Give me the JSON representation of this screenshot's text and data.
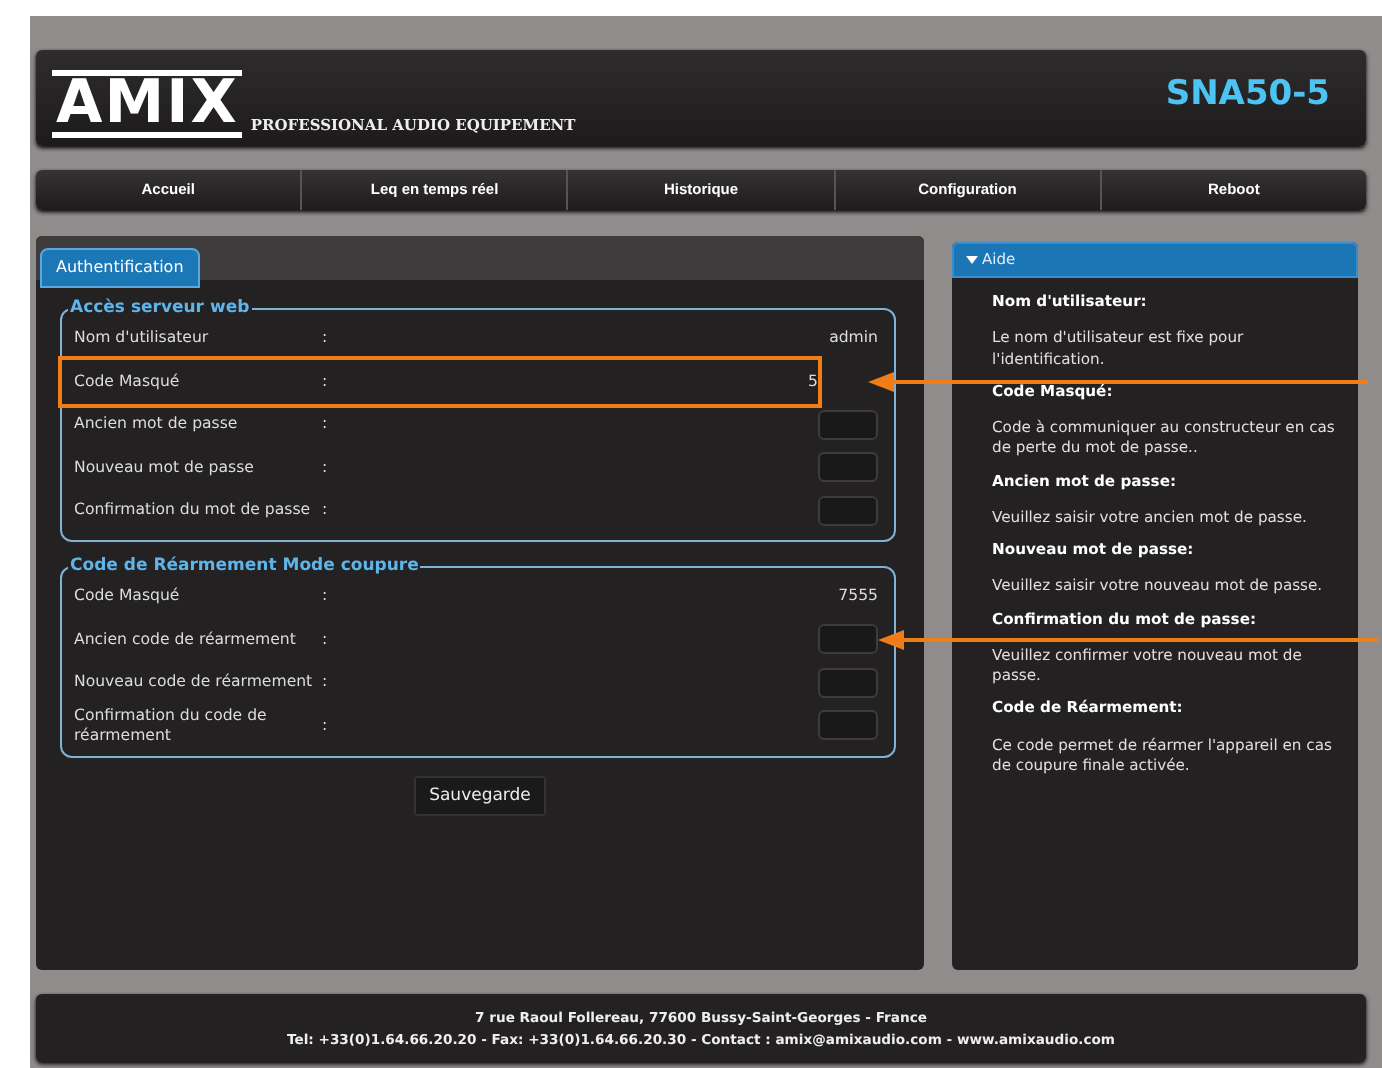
{
  "header": {
    "logo": "AMIX",
    "tagline": "PROFESSIONAL AUDIO EQUIPEMENT",
    "model": "SNA50-5"
  },
  "nav": [
    {
      "label": "Accueil"
    },
    {
      "label": "Leq en temps réel"
    },
    {
      "label": "Historique"
    },
    {
      "label": "Configuration"
    },
    {
      "label": "Reboot"
    }
  ],
  "tabs": [
    {
      "label": "Authentification",
      "selected": true
    }
  ],
  "sections": [
    {
      "title": "Accès serveur web",
      "rows": [
        {
          "label": "Nom d'utilisateur",
          "colon": ":",
          "kind": "text",
          "value": "admin",
          "highlighted": false,
          "arrow": false
        },
        {
          "label": "Code Masqué",
          "colon": ":",
          "kind": "text",
          "value": "5",
          "highlighted": true,
          "arrow": true
        },
        {
          "label": "Ancien mot de passe",
          "colon": ":",
          "kind": "input",
          "highlighted": false,
          "arrow": false
        },
        {
          "label": "Nouveau mot de passe",
          "colon": ":",
          "kind": "input",
          "highlighted": false,
          "arrow": false
        },
        {
          "label": "Confirmation du mot de passe",
          "colon": ":",
          "kind": "input",
          "highlighted": false,
          "arrow": false
        }
      ]
    },
    {
      "title": "Code de Réarmement Mode coupure",
      "rows": [
        {
          "label": "Code Masqué",
          "colon": ":",
          "kind": "text",
          "value": "7555",
          "highlighted": false,
          "arrow": false
        },
        {
          "label": "Ancien code de réarmement",
          "colon": ":",
          "kind": "input",
          "highlighted": false,
          "arrow": true
        },
        {
          "label": "Nouveau code de réarmement",
          "colon": ":",
          "kind": "input",
          "highlighted": false,
          "arrow": false
        },
        {
          "label": "Confirmation du code de réarmement",
          "colon": ":",
          "kind": "input",
          "highlighted": false,
          "arrow": false
        }
      ]
    }
  ],
  "save_button": "Sauvegarde",
  "help": {
    "title": "Aide",
    "expanded": true,
    "entries": [
      {
        "heading": "Nom d'utilisateur:",
        "text": "Le nom d'utilisateur est fixe pour l'identification."
      },
      {
        "heading": "Code Masqué:",
        "text": "Code à communiquer au constructeur en cas de perte du mot de passe.."
      },
      {
        "heading": "Ancien mot de passe:",
        "text": "Veuillez saisir votre ancien mot de passe."
      },
      {
        "heading": "Nouveau mot de passe:",
        "text": "Veuillez saisir votre nouveau mot de passe."
      },
      {
        "heading": "Confirmation du mot de passe:",
        "text": "Veuillez confirmer votre nouveau mot de passe."
      },
      {
        "heading": "Code de Réarmement:",
        "text": "Ce code permet de réarmer l'appareil en cas de coupure finale activée."
      }
    ]
  },
  "footer": {
    "lines": [
      "7 rue Raoul Follereau, 77600 Bussy-Saint-Georges - France",
      "Tel: +33(0)1.64.66.20.20 - Fax: +33(0)1.64.66.20.30 - Contact : amix@amixaudio.com - www.amixaudio.com"
    ]
  }
}
